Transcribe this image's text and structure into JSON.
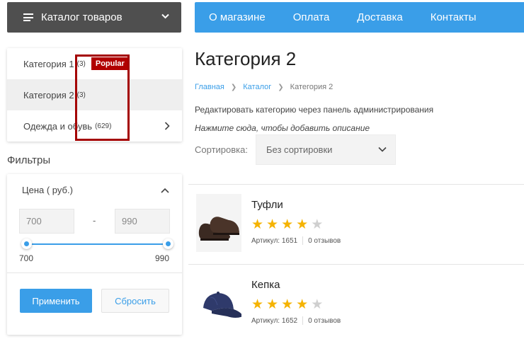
{
  "header": {
    "catalog_label": "Каталог товаров",
    "nav": [
      "О магазине",
      "Оплата",
      "Доставка",
      "Контакты"
    ]
  },
  "sidebar": {
    "categories": [
      {
        "label": "Категория 1",
        "count": "(3)",
        "badge": "Popular"
      },
      {
        "label": "Категория 2",
        "count": "(3)"
      },
      {
        "label": "Одежда и обувь",
        "count": "(629)"
      }
    ],
    "filters_title": "Фильтры",
    "price": {
      "label": "Цена ( руб.)",
      "min_value": "700",
      "max_value": "990",
      "dash": "-",
      "range_min": "700",
      "range_max": "990",
      "selected_range_fraction": [
        0,
        1
      ]
    },
    "apply_label": "Применить",
    "reset_label": "Сбросить"
  },
  "main": {
    "title": "Категория 2",
    "breadcrumbs": [
      "Главная",
      "Каталог",
      "Категория 2"
    ],
    "edit_text": "Редактировать категорию через панель администрирования",
    "desc_text": "Нажмите сюда, чтобы добавить описание",
    "sort_label": "Сортировка:",
    "sort_value": "Без сортировки",
    "products": [
      {
        "name": "Туфли",
        "rating": 4,
        "max_rating": 5,
        "sku": "Артикул: 1651",
        "reviews": "0 отзывов",
        "image": "shoes"
      },
      {
        "name": "Кепка",
        "rating": 4,
        "max_rating": 5,
        "sku": "Артикул: 1652",
        "reviews": "0 отзывов",
        "image": "cap"
      }
    ]
  },
  "colors": {
    "accent": "#3a9ee8",
    "dark_button": "#4f4f4f",
    "badge": "#b10000",
    "star": "#f5b301"
  }
}
